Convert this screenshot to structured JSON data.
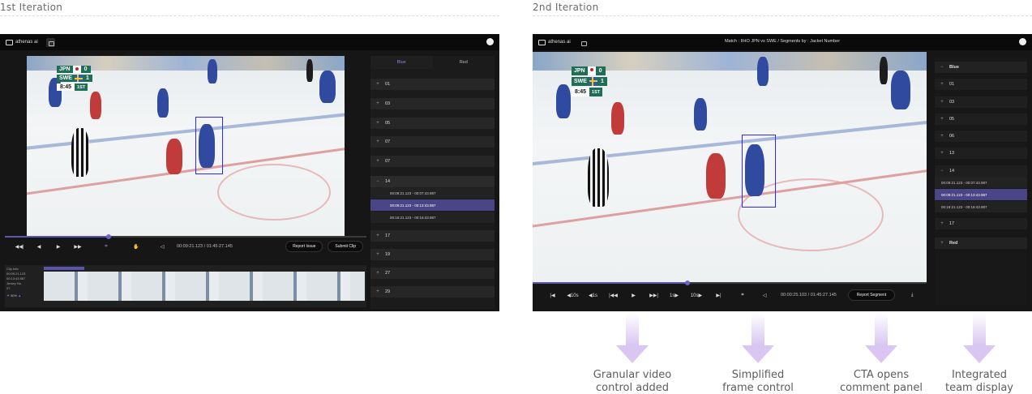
{
  "labels": {
    "first": "1st Iteration",
    "second": "2nd Iteration"
  },
  "app": {
    "logo": "athenas ai"
  },
  "first_iteration": {
    "tabs": [
      "Blue",
      "Red"
    ],
    "segments": [
      {
        "label": "01"
      },
      {
        "label": "03"
      },
      {
        "label": "05"
      },
      {
        "label": "07"
      },
      {
        "label": "07"
      },
      {
        "label": "14",
        "expanded": true,
        "clips": [
          "00:09:21.123 - 00:07:43.987",
          "00:09:21.123 - 00:13:43.987",
          "00:16:21.123 - 00:16:43.987"
        ],
        "selected_clip": 1
      },
      {
        "label": "17"
      },
      {
        "label": "19"
      },
      {
        "label": "27"
      },
      {
        "label": "29"
      }
    ],
    "timecode": "00:09:21.123 / 01:45:27.145",
    "report_button": "Report Issue",
    "submit_button": "Submit Clip",
    "clip_info": {
      "label1": "Clip Info",
      "start": "00:09:21.123",
      "end": "00:13:43.987",
      "label2": "Jersey No.",
      "jersey": "27",
      "zoom": "50%"
    }
  },
  "second_iteration": {
    "match_title": "Match : IIHO JPN vs SWE / Segments by : Jacket Number",
    "teams": [
      {
        "name": "Blue",
        "segments": [
          "01",
          "03",
          "05",
          "06",
          "13"
        ]
      },
      {
        "name": "Red"
      }
    ],
    "expanded_segment": {
      "label": "14",
      "clips": [
        "00:09:21.123 - 00:07:43.987",
        "00:09:21.123 - 00:13:43.987",
        "00:16:21.123 - 00:16:43.987"
      ],
      "selected_clip": 1
    },
    "after_segment": "17",
    "timecode": "00:00:25.103 / 01:45:27.145",
    "report_button": "Report Segment",
    "controls": [
      "|◀",
      "◀10s",
      "◀1s",
      "|◀◀",
      "▶",
      "▶▶|",
      "1s▶",
      "10s▶",
      "▶|"
    ]
  },
  "scoreboard": {
    "team1": "JPN",
    "score1": "0",
    "team2": "SWE",
    "score2": "1",
    "clock": "8:45",
    "period": "1ST"
  },
  "annotations": [
    {
      "line1": "Granular video",
      "line2": "control added"
    },
    {
      "line1": "Simplified",
      "line2": "frame control"
    },
    {
      "line1": "CTA opens",
      "line2": "comment panel"
    },
    {
      "line1": "Integrated",
      "line2": "team display"
    }
  ]
}
